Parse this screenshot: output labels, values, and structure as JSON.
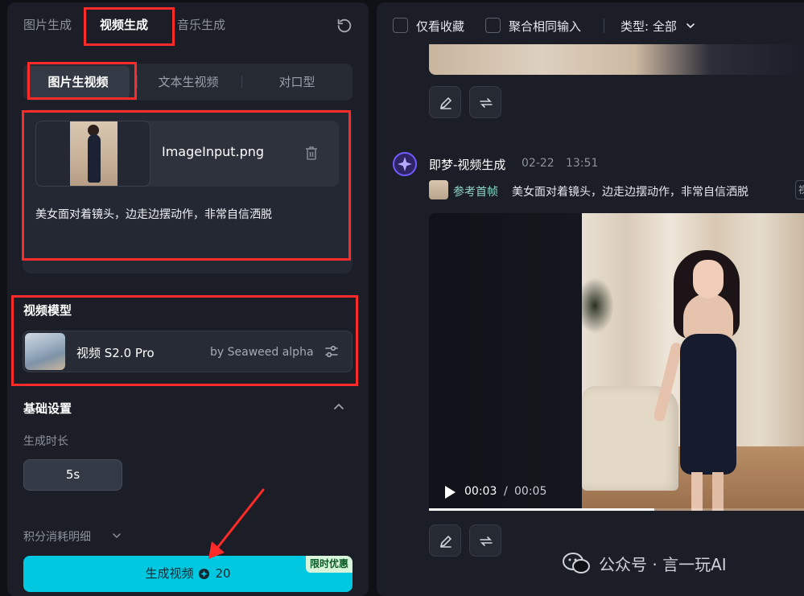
{
  "left_panel": {
    "top_tabs": [
      {
        "label": "图片生成",
        "active": false
      },
      {
        "label": "视频生成",
        "active": true
      },
      {
        "label": "音乐生成",
        "active": false
      }
    ],
    "reset_icon": "refresh-icon",
    "sub_tabs": [
      {
        "label": "图片生视频",
        "active": true
      },
      {
        "label": "文本生视频",
        "active": false
      },
      {
        "label": "对口型",
        "active": false
      }
    ],
    "upload": {
      "file_name": "ImageInput.png",
      "delete_icon": "trash-icon"
    },
    "prompt_text": "美女面对着镜头，边走边摆动作，非常自信洒脱",
    "model_section": {
      "title": "视频模型",
      "model_name": "视频 S2.0 Pro",
      "model_by": "by Seaweed alpha",
      "settings_icon": "sliders-icon"
    },
    "basic_settings": {
      "title": "基础设置",
      "duration_label": "生成时长",
      "duration_value": "5s"
    },
    "credit_link": "积分消耗明细",
    "generate_button": {
      "label": "生成视频",
      "cost": "20",
      "promo_badge": "限时优惠"
    },
    "highlight_color": "#ff2a2a",
    "accent_color": "#00c8e0"
  },
  "right_panel": {
    "filters": {
      "only_favorites": "仅看收藏",
      "merge_inputs": "聚合相同输入",
      "type_filter": "类型: 全部"
    },
    "message": {
      "agent_name": "即梦-视频生成",
      "date": "02-22",
      "time": "13:51",
      "ref_label": "参考首帧",
      "prompt": "美女面对着镜头，边走边摆动作，非常自信洒脱",
      "ref_more": "视"
    },
    "video": {
      "current_time": "00:03",
      "separator": "/",
      "total_time": "00:05",
      "progress": 0.6
    }
  },
  "watermark": {
    "text": "公众号 · 言一玩AI"
  }
}
